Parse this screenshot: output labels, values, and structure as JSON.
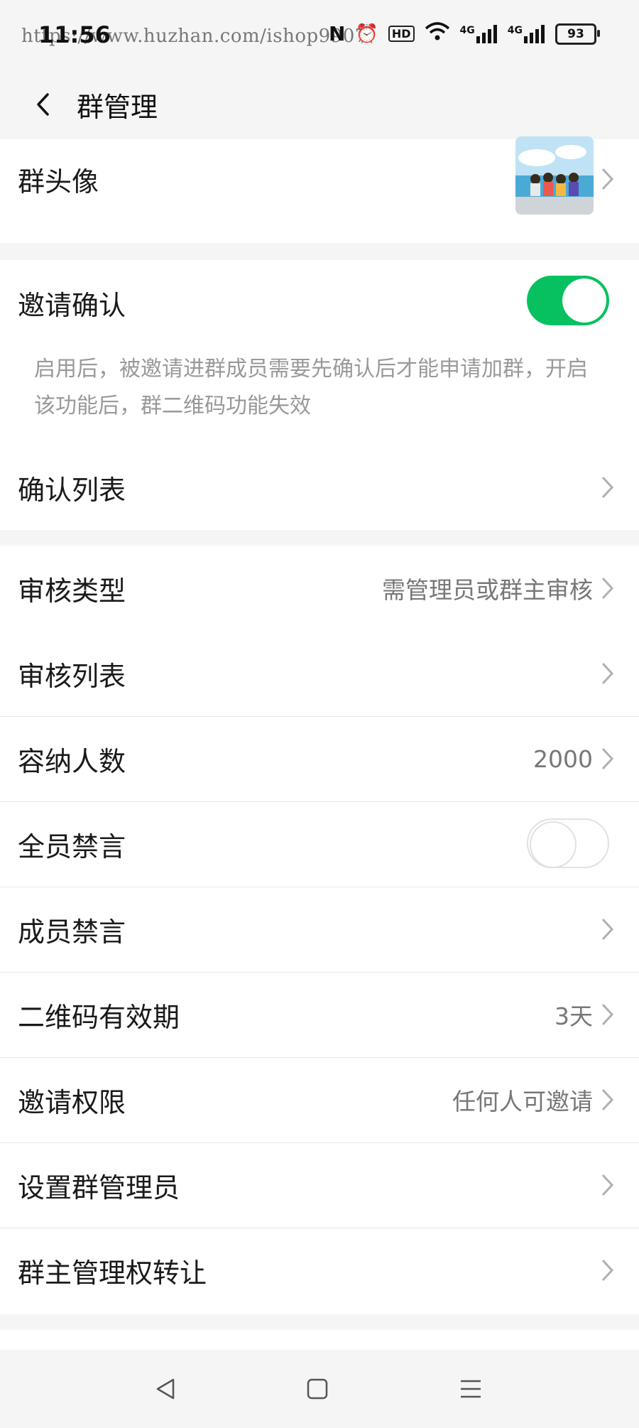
{
  "status_bar": {
    "time": "11:56",
    "watermark": "https://www.huzhan.com/ishop9907",
    "network_1": "4G",
    "network_2": "4G",
    "hd_label": "HD",
    "battery": "93"
  },
  "header": {
    "title": "群管理"
  },
  "avatar_row": {
    "label": "群头像"
  },
  "invite_confirm": {
    "label": "邀请确认",
    "enabled": true,
    "description": "启用后，被邀请进群成员需要先确认后才能申请加群，开启该功能后，群二维码功能失效"
  },
  "confirm_list": {
    "label": "确认列表"
  },
  "settings": {
    "review_type": {
      "label": "审核类型",
      "value": "需管理员或群主审核"
    },
    "review_list": {
      "label": "审核列表"
    },
    "capacity": {
      "label": "容纳人数",
      "value": "2000"
    },
    "mute_all": {
      "label": "全员禁言",
      "enabled": false
    },
    "member_mute": {
      "label": "成员禁言"
    },
    "qr_validity": {
      "label": "二维码有效期",
      "value": "3天"
    },
    "invite_permission": {
      "label": "邀请权限",
      "value": "任何人可邀请"
    },
    "set_admin": {
      "label": "设置群管理员"
    },
    "transfer_owner": {
      "label": "群主管理权转让"
    }
  },
  "colors": {
    "accent_green": "#07c160",
    "background": "#f5f5f5",
    "secondary_text": "#777777"
  }
}
